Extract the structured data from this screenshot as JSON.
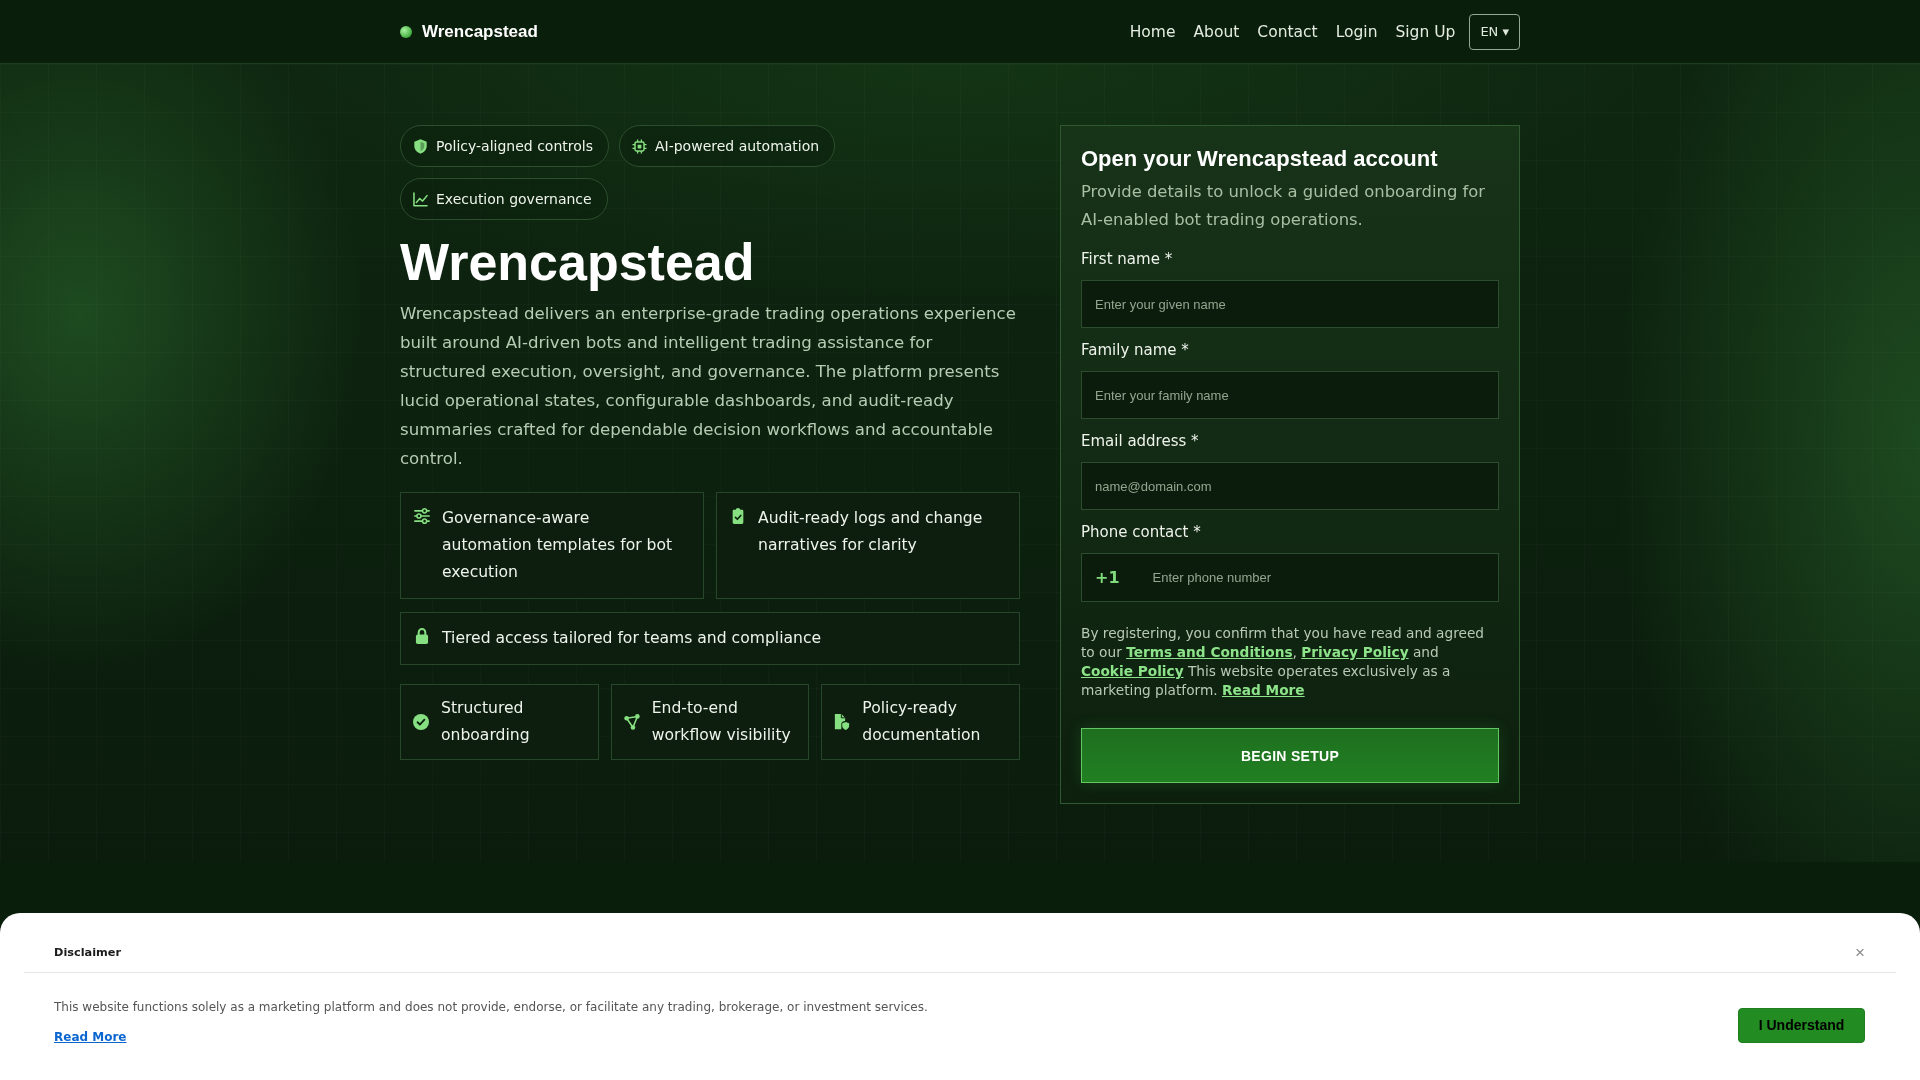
{
  "header": {
    "brand": "Wrencapstead",
    "nav": [
      {
        "label": "Home"
      },
      {
        "label": "About"
      },
      {
        "label": "Contact"
      },
      {
        "label": "Login"
      },
      {
        "label": "Sign Up"
      }
    ],
    "language": "EN ▾"
  },
  "hero": {
    "badges": [
      {
        "label": "Policy-aligned controls"
      },
      {
        "label": "AI-powered automation"
      },
      {
        "label": "Execution governance"
      }
    ],
    "title": "Wrencapstead",
    "description": "Wrencapstead delivers an enterprise-grade trading operations experience built around AI-driven bots and intelligent trading assistance for structured execution, oversight, and governance. The platform presents lucid operational states, configurable dashboards, and audit-ready summaries crafted for dependable decision workflows and accountable control.",
    "features": [
      {
        "text": "Governance-aware automation templates for bot execution"
      },
      {
        "text": "Audit-ready logs and change narratives for clarity"
      },
      {
        "text": "Tiered access tailored for teams and compliance"
      }
    ],
    "highlights": [
      {
        "text": "Structured onboarding"
      },
      {
        "text": "End-to-end workflow visibility"
      },
      {
        "text": "Policy-ready documentation"
      }
    ]
  },
  "signup": {
    "title": "Open your Wrencapstead account",
    "subtitle": "Provide details to unlock a guided onboarding for AI-enabled bot trading operations.",
    "fields": [
      {
        "kind": "text",
        "label": "First name *",
        "placeholder": "Enter your given name"
      },
      {
        "kind": "text",
        "label": "Family name *",
        "placeholder": "Enter your family name"
      },
      {
        "kind": "email",
        "label": "Email address *",
        "placeholder": "name@domain.com"
      },
      {
        "kind": "phone",
        "label": "Phone contact *",
        "prefix": "+1",
        "placeholder": "Enter phone number"
      }
    ],
    "consent": [
      {
        "kind": "text",
        "text": "By registering, you confirm that you have read and agreed to our "
      },
      {
        "kind": "link",
        "text": "Terms and Conditions"
      },
      {
        "kind": "text",
        "text": ", "
      },
      {
        "kind": "link",
        "text": "Privacy Policy"
      },
      {
        "kind": "text",
        "text": " and "
      },
      {
        "kind": "link",
        "text": "Cookie Policy"
      },
      {
        "kind": "text",
        "text": " This website operates exclusively as a marketing platform. "
      },
      {
        "kind": "link",
        "text": "Read More"
      }
    ],
    "submit": "BEGIN SETUP"
  },
  "disclaimer": {
    "title": "Disclaimer",
    "close": "×",
    "text": "This website functions solely as a marketing platform and does not provide, endorse, or facilitate any trading, brokerage, or investment services.",
    "link": "Read More",
    "button": "I Understand"
  }
}
